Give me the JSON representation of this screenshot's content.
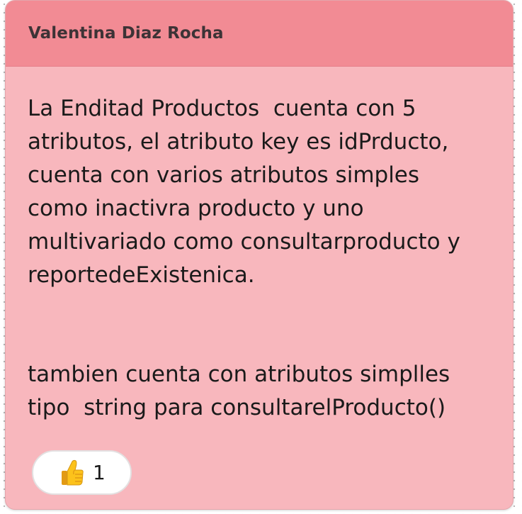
{
  "post": {
    "author": "Valentina Diaz Rocha",
    "paragraph1": "La Enditad Productos  cuenta con 5\natributos, el atributo key es idPrducto,\ncuenta con varios atributos simples\ncomo inactivra producto y uno\nmultivariado como consultarproducto y\nreportedeExistenica.",
    "paragraph2": "tambien cuenta con atributos simplles\ntipo  string para consultarelProducto()"
  },
  "reaction": {
    "icon": "thumbs-up-icon",
    "count": "1"
  },
  "colors": {
    "card_bg": "#f8b7bd",
    "header_bg": "#f28b94"
  }
}
